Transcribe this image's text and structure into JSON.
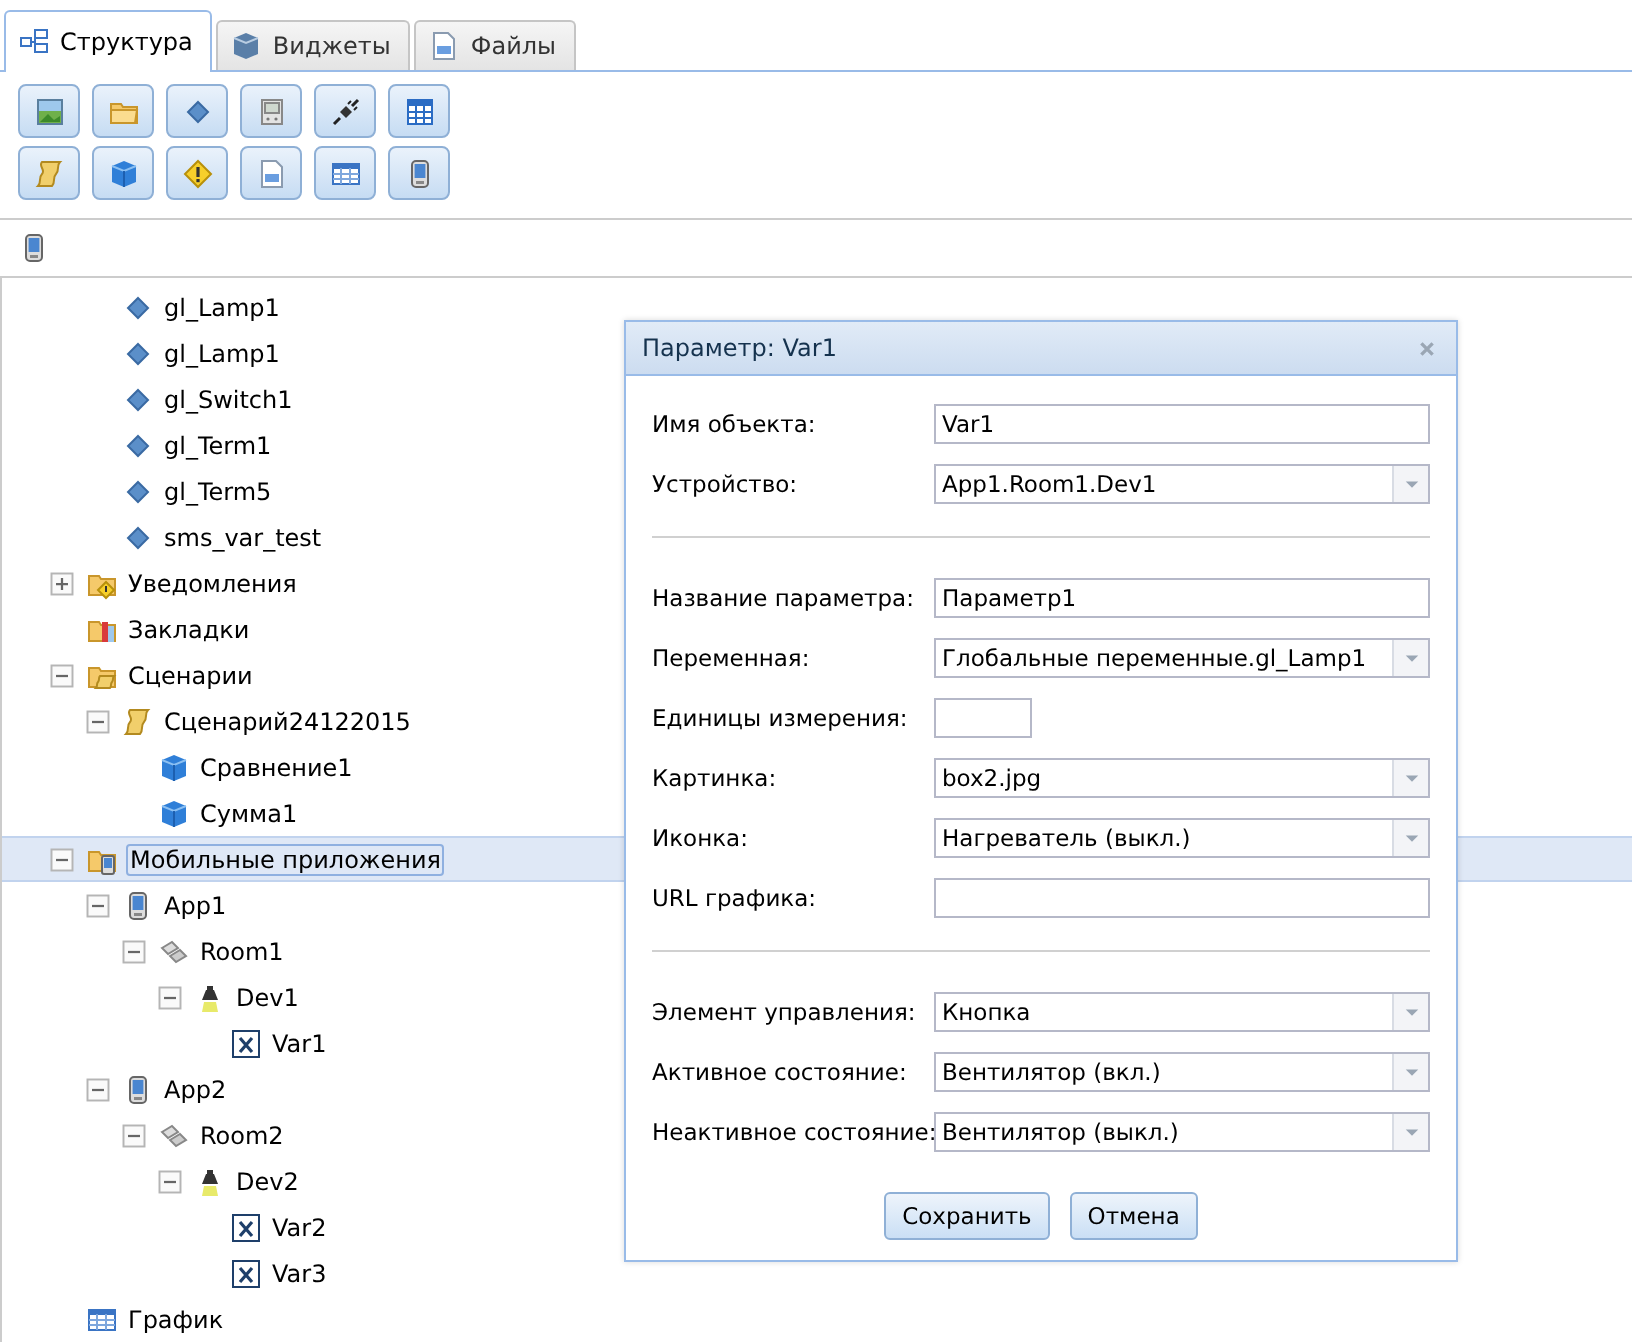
{
  "tabs": [
    {
      "label": "Структура",
      "kind": "structure",
      "selected": true
    },
    {
      "label": "Виджеты",
      "kind": "widgets",
      "selected": false
    },
    {
      "label": "Файлы",
      "kind": "files",
      "selected": false
    }
  ],
  "toolbar": {
    "rows": [
      [
        {
          "kind": "picture"
        },
        {
          "kind": "folder"
        },
        {
          "kind": "variable"
        },
        {
          "kind": "device"
        },
        {
          "kind": "plug"
        },
        {
          "kind": "table"
        }
      ],
      [
        {
          "kind": "scenario"
        },
        {
          "kind": "block"
        },
        {
          "kind": "warning"
        },
        {
          "kind": "file"
        },
        {
          "kind": "grid"
        },
        {
          "kind": "phone"
        }
      ]
    ]
  },
  "subtoolbar": [
    {
      "kind": "phone"
    }
  ],
  "tree": [
    {
      "children": [
        {
          "label": "gl_Lamp1",
          "kind": "variable",
          "selected": false
        },
        {
          "label": "gl_Lamp1",
          "kind": "variable",
          "selected": false
        },
        {
          "label": "gl_Switch1",
          "kind": "variable",
          "selected": false
        },
        {
          "label": "gl_Term1",
          "kind": "variable",
          "selected": false
        },
        {
          "label": "gl_Term5",
          "kind": "variable",
          "selected": false
        },
        {
          "label": "sms_var_test",
          "kind": "variable",
          "selected": false
        }
      ]
    },
    {
      "label": "Уведомления",
      "kind": "warning-folder",
      "expanded": false,
      "selected": false
    },
    {
      "label": "Закладки",
      "kind": "bookmark-folder",
      "selected": false
    },
    {
      "label": "Сценарии",
      "kind": "scenario-folder",
      "expanded": true,
      "selected": false,
      "children": [
        {
          "label": "Сценарий24122015",
          "kind": "scenario",
          "expanded": true,
          "selected": false,
          "children": [
            {
              "label": "Сравнение1",
              "kind": "block",
              "selected": false
            },
            {
              "label": "Сумма1",
              "kind": "block",
              "selected": false
            }
          ]
        }
      ]
    },
    {
      "label": "Мобильные приложения",
      "kind": "phone-folder",
      "expanded": true,
      "selected": true,
      "children": [
        {
          "label": "App1",
          "kind": "phone",
          "expanded": true,
          "selected": false,
          "children": [
            {
              "label": "Room1",
              "kind": "room",
              "expanded": true,
              "selected": false,
              "children": [
                {
                  "label": "Dev1",
                  "kind": "device",
                  "expanded": true,
                  "selected": false,
                  "children": [
                    {
                      "label": "Var1",
                      "kind": "param",
                      "selected": false
                    }
                  ]
                }
              ]
            }
          ]
        },
        {
          "label": "App2",
          "kind": "phone",
          "expanded": true,
          "selected": false,
          "children": [
            {
              "label": "Room2",
              "kind": "room",
              "expanded": true,
              "selected": false,
              "children": [
                {
                  "label": "Dev2",
                  "kind": "device",
                  "expanded": true,
                  "selected": false,
                  "children": [
                    {
                      "label": "Var2",
                      "kind": "param",
                      "selected": false
                    },
                    {
                      "label": "Var3",
                      "kind": "param",
                      "selected": false
                    }
                  ]
                }
              ]
            }
          ]
        }
      ]
    },
    {
      "label": "График",
      "kind": "grid",
      "selected": false
    }
  ],
  "dialog": {
    "title": "Параметр: Var1",
    "sections": [
      [
        {
          "label": "Имя объекта:",
          "kind": "text",
          "value": "Var1"
        },
        {
          "label": "Устройство:",
          "kind": "combo",
          "value": "App1.Room1.Dev1"
        }
      ],
      [
        {
          "label": "Название параметра:",
          "kind": "text",
          "value": "Параметр1"
        },
        {
          "label": "Переменная:",
          "kind": "combo",
          "value": "Глобальные переменные.gl_Lamp1"
        },
        {
          "label": "Единицы измерения:",
          "kind": "short"
        },
        {
          "label": "Картинка:",
          "kind": "combo",
          "value": "box2.jpg"
        },
        {
          "label": "Иконка:",
          "kind": "combo",
          "value": "Нагреватель (выкл.)"
        },
        {
          "label": "URL графика:",
          "kind": "text"
        }
      ],
      [
        {
          "label": "Элемент управления:",
          "kind": "combo",
          "value": "Кнопка"
        },
        {
          "label": "Активное состояние:",
          "kind": "combo",
          "value": "Вентилятор (вкл.)"
        },
        {
          "label": "Неактивное состояние:",
          "kind": "combo",
          "value": "Вентилятор (выкл.)"
        }
      ]
    ],
    "buttons": [
      "Сохранить",
      "Отмена"
    ]
  }
}
